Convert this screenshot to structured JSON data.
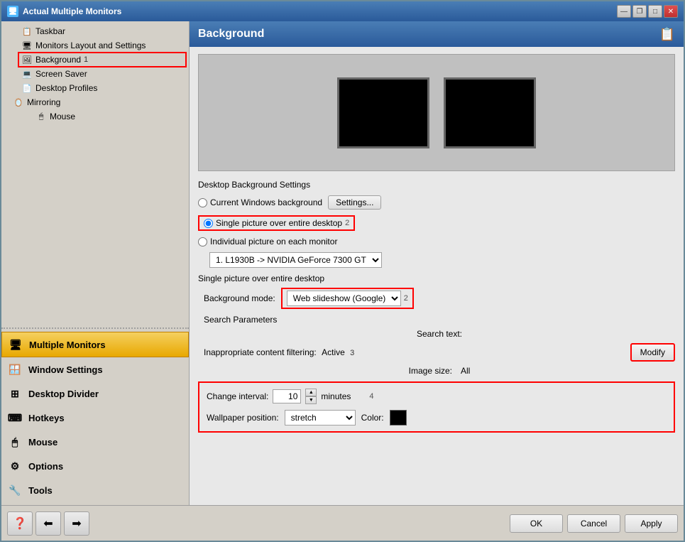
{
  "window": {
    "title": "Actual Multiple Monitors",
    "titleIcon": "🖥"
  },
  "titlebar_buttons": {
    "minimize": "—",
    "maximize": "□",
    "restore": "❐",
    "close": "✕"
  },
  "sidebar": {
    "tree_items": [
      {
        "label": "Taskbar",
        "icon": "📋",
        "indent": 1,
        "id": "taskbar"
      },
      {
        "label": "Monitors Layout and Settings",
        "icon": "🖥",
        "indent": 1,
        "id": "monitors-layout"
      },
      {
        "label": "Background",
        "icon": "🖼",
        "indent": 1,
        "id": "background",
        "badge": "1",
        "selected": false,
        "highlighted": true
      },
      {
        "label": "Screen Saver",
        "icon": "💻",
        "indent": 1,
        "id": "screen-saver"
      },
      {
        "label": "Desktop Profiles",
        "icon": "📄",
        "indent": 1,
        "id": "desktop-profiles"
      },
      {
        "label": "Mirroring",
        "icon": "🪞",
        "indent": 0,
        "id": "mirroring"
      },
      {
        "label": "Mouse",
        "icon": "🖱",
        "indent": 2,
        "id": "mouse"
      }
    ],
    "nav_items": [
      {
        "label": "Multiple Monitors",
        "icon": "🖥",
        "id": "multiple-monitors",
        "active": true
      },
      {
        "label": "Window Settings",
        "icon": "🪟",
        "id": "window-settings"
      },
      {
        "label": "Desktop Divider",
        "icon": "⊞",
        "id": "desktop-divider"
      },
      {
        "label": "Hotkeys",
        "icon": "⌨",
        "id": "hotkeys"
      },
      {
        "label": "Mouse",
        "icon": "🖱",
        "id": "mouse-nav"
      },
      {
        "label": "Options",
        "icon": "⚙",
        "id": "options"
      },
      {
        "label": "Tools",
        "icon": "🔧",
        "id": "tools"
      }
    ]
  },
  "bottom_bar": {
    "icons": [
      "❓",
      "⬅",
      "➡"
    ]
  },
  "dialog_buttons": {
    "ok": "OK",
    "cancel": "Cancel",
    "apply": "Apply"
  },
  "right_panel": {
    "header": "Background",
    "header_icon": "📋",
    "section_title": "Desktop Background Settings",
    "radio_current": "Current Windows background",
    "settings_btn": "Settings...",
    "radio_single": "Single picture over entire desktop",
    "single_badge": "2",
    "radio_individual": "Individual picture on each monitor",
    "monitor_option": "1. L1930B -> NVIDIA GeForce 7300 GT",
    "subsection_label": "Single picture over entire desktop",
    "bg_mode_label": "Background mode:",
    "bg_mode_value": "Web slideshow (Google)",
    "bg_mode_badge": "2",
    "search_params_label": "Search Parameters",
    "search_text_label": "Search text:",
    "search_text_value": "",
    "filtering_label": "Inappropriate content filtering:",
    "filtering_value": "Active",
    "filtering_badge": "3",
    "image_size_label": "Image size:",
    "image_size_value": "All",
    "modify_btn": "Modify",
    "change_interval_label": "Change interval:",
    "change_interval_value": "10",
    "change_interval_unit": "minutes",
    "change_interval_badge": "4",
    "wallpaper_position_label": "Wallpaper position:",
    "wallpaper_position_value": "stretch",
    "color_label": "Color:",
    "color_value": "#000000"
  }
}
